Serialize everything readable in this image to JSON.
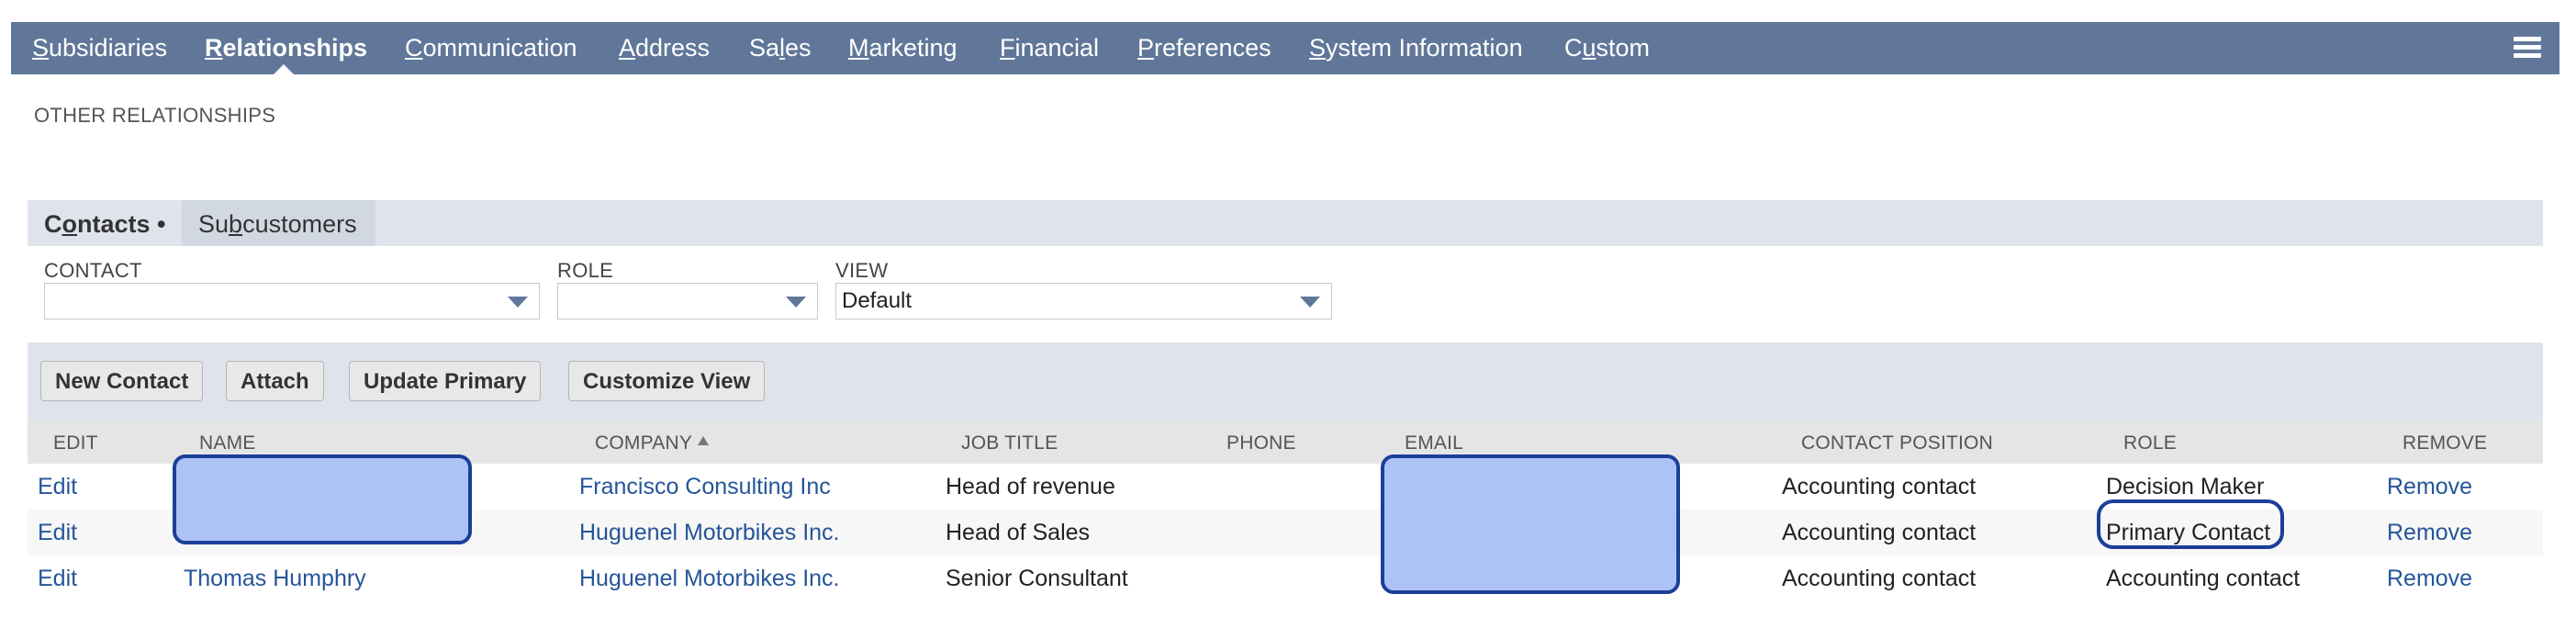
{
  "top_tabs": [
    {
      "pre": "",
      "key": "S",
      "post": "ubsidiaries"
    },
    {
      "pre": "",
      "key": "R",
      "post": "elationships"
    },
    {
      "pre": "",
      "key": "C",
      "post": "ommunication"
    },
    {
      "pre": "",
      "key": "A",
      "post": "ddress"
    },
    {
      "pre": "Sa",
      "key": "l",
      "post": "es"
    },
    {
      "pre": "",
      "key": "M",
      "post": "arketing"
    },
    {
      "pre": "",
      "key": "F",
      "post": "inancial"
    },
    {
      "pre": "",
      "key": "P",
      "post": "references"
    },
    {
      "pre": "",
      "key": "S",
      "post": "ystem Information"
    },
    {
      "pre": "C",
      "key": "u",
      "post": "stom"
    }
  ],
  "menu_icon": "hamburger-menu-icon",
  "section_label": "OTHER RELATIONSHIPS",
  "subtabs": [
    {
      "pre": "C",
      "key": "o",
      "post": "ntacts",
      "suffix": " •"
    },
    {
      "pre": "Su",
      "key": "b",
      "post": "customers",
      "suffix": ""
    }
  ],
  "filters": {
    "contact": {
      "label": "CONTACT",
      "value": ""
    },
    "role": {
      "label": "ROLE",
      "value": ""
    },
    "view": {
      "label": "VIEW",
      "value": "Default"
    }
  },
  "buttons": {
    "new_contact": "New Contact",
    "attach": "Attach",
    "update_primary": "Update Primary",
    "customize_view": "Customize View"
  },
  "columns": {
    "edit": "EDIT",
    "name": "NAME",
    "company": "COMPANY",
    "job_title": "JOB TITLE",
    "phone": "PHONE",
    "email": "EMAIL",
    "contact_position": "CONTACT POSITION",
    "role": "ROLE",
    "remove": "REMOVE"
  },
  "rows": [
    {
      "edit": "Edit",
      "name": "",
      "company": "Francisco Consulting Inc",
      "job_title": "Head of revenue",
      "phone": "",
      "email": "",
      "contact_position": "Accounting contact",
      "role": "Decision Maker",
      "remove": "Remove"
    },
    {
      "edit": "Edit",
      "name": "",
      "company": "Huguenel Motorbikes Inc.",
      "job_title": "Head of Sales",
      "phone": "",
      "email": "",
      "contact_position": "Accounting contact",
      "role": "Primary Contact",
      "remove": "Remove"
    },
    {
      "edit": "Edit",
      "name": "Thomas Humphry",
      "company": "Huguenel Motorbikes Inc.",
      "job_title": "Senior Consultant",
      "phone": "",
      "email": "",
      "contact_position": "Accounting contact",
      "role": "Accounting contact",
      "remove": "Remove"
    }
  ],
  "colors": {
    "tab_bar": "#607799",
    "link": "#255599",
    "redaction_fill": "#adc3f5",
    "redaction_border": "#1b3f99"
  }
}
